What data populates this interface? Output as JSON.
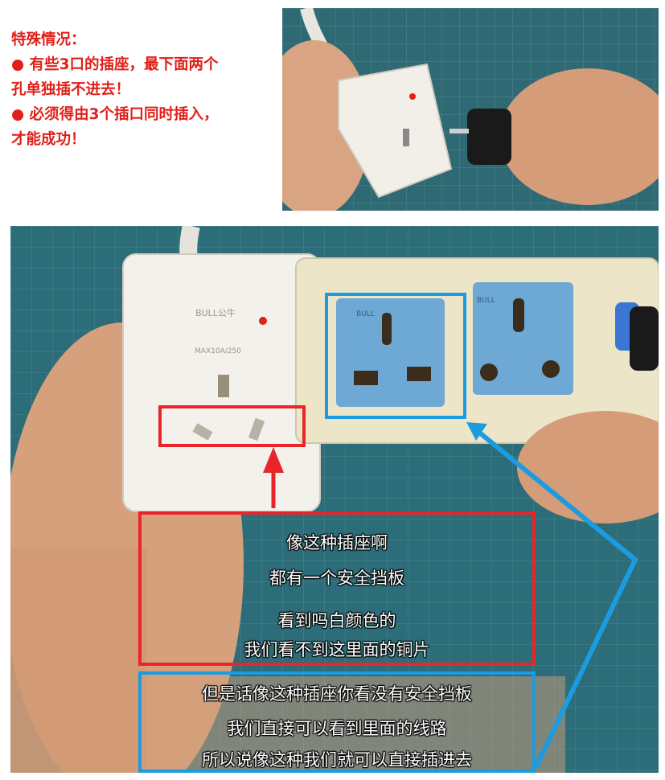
{
  "note": {
    "heading": "特殊情况：",
    "bullet1_line1": "● 有些3口的插座，最下面两个",
    "bullet1_line2": "孔单独插不进去！",
    "bullet2_line1": "● 必须得由3个插口同时插入，",
    "bullet2_line2": "才能成功！"
  },
  "photo_labels": {
    "brand_left": "BULL公牛",
    "rating": "MAX10A/250",
    "brand_socket1": "BULL",
    "brand_socket2": "BULL"
  },
  "subtitles_red": [
    "像这种插座啊",
    "都有一个安全挡板",
    "看到吗白颜色的",
    "我们看不到这里面的铜片"
  ],
  "subtitles_blue": [
    "但是话像这种插座你看没有安全挡板",
    "我们直接可以看到里面的线路",
    "所以说像这种我们就可以直接插进去"
  ],
  "colors": {
    "note_red": "#e0201a",
    "highlight_red": "#e8262a",
    "highlight_blue": "#1c9ce0",
    "mat": "#2c6d79",
    "socket_blue": "#6ea9d6"
  }
}
